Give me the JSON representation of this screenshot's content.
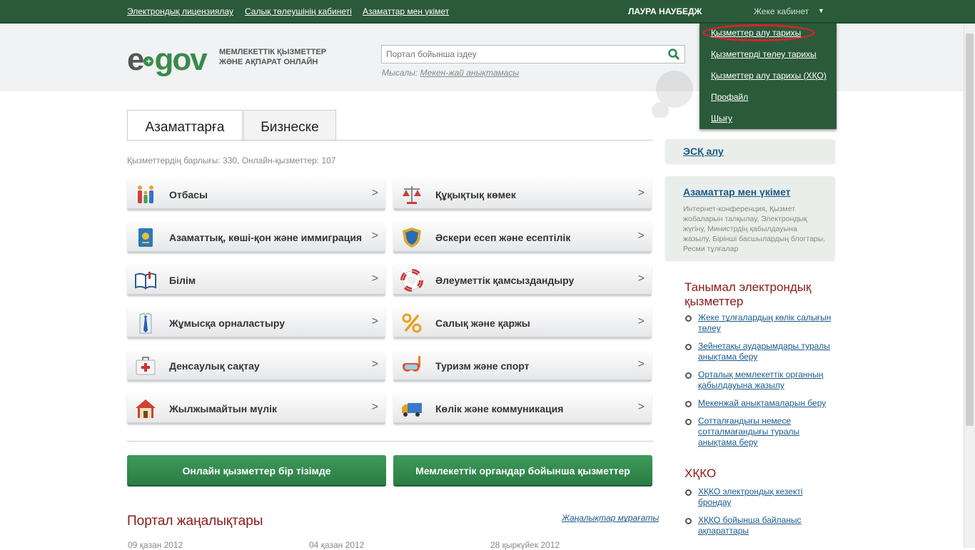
{
  "topbar": {
    "links": [
      "Электрондық лицензиялау",
      "Салық төлеушінің кабинеті",
      "Азаматтар мен үкімет"
    ],
    "user_name": "ЛАУРА НАУБЕДЖ",
    "cabinet_label": "Жеке кабинет"
  },
  "dropdown": {
    "items": [
      "Қызметтер алу тарихы",
      "Қызметтерді төлеу тарихы",
      "Қызметтер алу тарихы (ХҚО)",
      "Профайл",
      "Шығу"
    ],
    "highlighted_index": 0
  },
  "header": {
    "logo_e": "e",
    "logo_gov": "gov",
    "tagline_1": "МЕМЛЕКЕТТІК ҚЫЗМЕТТЕР",
    "tagline_2": "ЖӘНЕ АҚПАРАТ ОНЛАЙН",
    "search_placeholder": "Портал бойынша іздеу",
    "example_label": "Мысалы:",
    "example_link": "Мекен-жай анықтамасы"
  },
  "tabs": [
    "Азаматтарға",
    "Бизнеске"
  ],
  "counts": "Қызметтердің барлығы: 330, Онлайн-қызметтер: 107",
  "categories": [
    {
      "label": "Отбасы",
      "icon": "family-icon"
    },
    {
      "label": "Құқықтық көмек",
      "icon": "scales-icon"
    },
    {
      "label": "Азаматтық, көші-қон және иммиграция",
      "icon": "passport-icon"
    },
    {
      "label": "Әскери есеп және есептілік",
      "icon": "shield-icon"
    },
    {
      "label": "Білім",
      "icon": "book-icon"
    },
    {
      "label": "Әлеуметтік қамсыздандыру",
      "icon": "lifebuoy-icon"
    },
    {
      "label": "Жұмысқа орналастыру",
      "icon": "shirt-tie-icon"
    },
    {
      "label": "Салық және қаржы",
      "icon": "percent-icon"
    },
    {
      "label": "Денсаулық сақтау",
      "icon": "first-aid-icon"
    },
    {
      "label": "Туризм және спорт",
      "icon": "snorkel-mask-icon"
    },
    {
      "label": "Жылжымайтын мүлік",
      "icon": "house-icon"
    },
    {
      "label": "Көлік және коммуникация",
      "icon": "truck-icon"
    }
  ],
  "buttons": [
    "Онлайн қызметтер бір тізімде",
    "Мемлекеттік органдар бойынша қызметтер"
  ],
  "news": {
    "title": "Портал жаңалықтары",
    "archive": "Жаңалықтар мұрағаты",
    "dates": [
      "09 қазан 2012",
      "04 қазан 2012",
      "28 қыркүйек 2012"
    ]
  },
  "sidebar": {
    "esk": "ЭСҚ алу",
    "gov_title": "Азаматтар мен үкімет",
    "gov_desc": "Интернет-конференция, Қызмет жобаларын талқылау, Электрондық жүгіну, Министрдің қабылдауына жазылу, Бірінші басшылардың блогтары, Ресми тұлғалар",
    "popular_title": "Танымал электрондық қызметтер",
    "popular": [
      "Жеке тұлғалардың көлік салығын төлеу",
      "Зейнетақы аударымдары туралы анықтама беру",
      "Орталық мемлекеттік органның қабылдауына жазылу",
      "Мекенжай анықтамаларын беру",
      "Сотталғандығы немесе сотталмағандығы туралы анықтама беру"
    ],
    "hkko_title": "ХҚКО",
    "hkko": [
      "ХҚКО электрондық кезекті брондау",
      "ХҚКО бойынша байланыс ақпараттары"
    ]
  }
}
